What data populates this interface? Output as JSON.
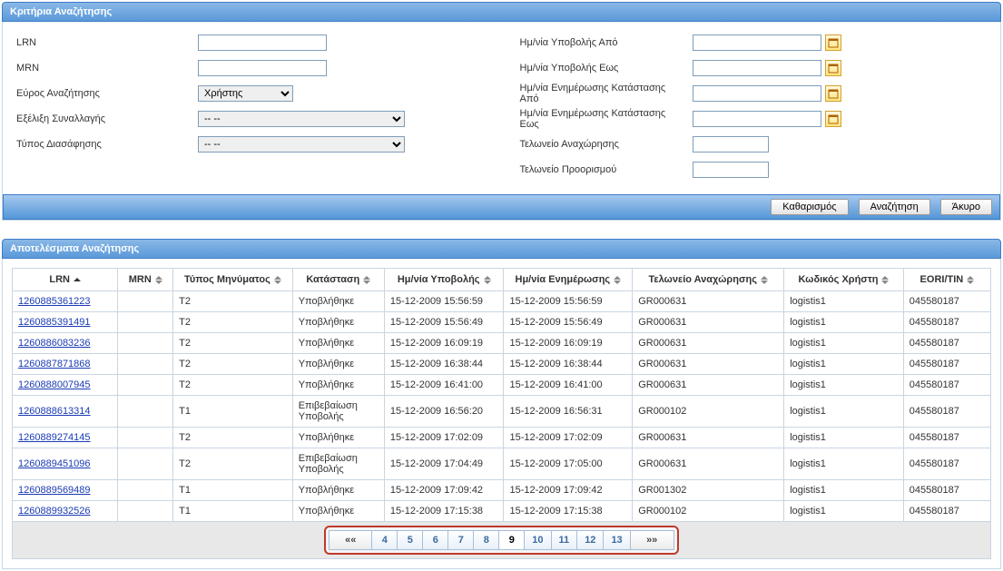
{
  "criteria": {
    "title": "Κριτήρια Αναζήτησης",
    "labels": {
      "lrn": "LRN",
      "mrn": "MRN",
      "scope": "Εύρος Αναζήτησης",
      "progress": "Εξέλιξη Συναλλαγής",
      "declType": "Τύπος Διασάφησης",
      "dateFrom": "Ημ/νία Υποβολής Από",
      "dateTo": "Ημ/νία Υποβολής Εως",
      "updateFrom": "Ημ/νία Ενημέρωσης Κατάστασης Από",
      "updateTo": "Ημ/νία Ενημέρωσης Κατάστασης Εως",
      "customsDep": "Τελωνείο Αναχώρησης",
      "customsDest": "Τελωνείο Προορισμού"
    },
    "values": {
      "lrn": "",
      "mrn": "",
      "scope": "Χρήστης",
      "progress": "-- --",
      "declType": "-- --",
      "dateFrom": "",
      "dateTo": "",
      "updateFrom": "",
      "updateTo": "",
      "customsDep": "",
      "customsDest": ""
    },
    "buttons": {
      "clear": "Καθαρισμός",
      "search": "Αναζήτηση",
      "cancel": "Άκυρο"
    }
  },
  "results": {
    "title": "Αποτελέσματα Αναζήτησης",
    "columns": {
      "lrn": "LRN",
      "mrn": "MRN",
      "msgType": "Τύπος Μηνύματος",
      "status": "Κατάσταση",
      "submitDate": "Ημ/νία Υποβολής",
      "updateDate": "Ημ/νία Ενημέρωσης",
      "customsDep": "Τελωνείο Αναχώρησης",
      "userCode": "Κωδικός Χρήστη",
      "eori": "EORI/TIN"
    },
    "rows": [
      {
        "lrn": "1260885361223",
        "mrn": "",
        "msgType": "T2",
        "status": "Υποβλήθηκε",
        "submitDate": "15-12-2009 15:56:59",
        "updateDate": "15-12-2009 15:56:59",
        "customsDep": "GR000631",
        "userCode": "logistis1",
        "eori": "045580187"
      },
      {
        "lrn": "1260885391491",
        "mrn": "",
        "msgType": "T2",
        "status": "Υποβλήθηκε",
        "submitDate": "15-12-2009 15:56:49",
        "updateDate": "15-12-2009 15:56:49",
        "customsDep": "GR000631",
        "userCode": "logistis1",
        "eori": "045580187"
      },
      {
        "lrn": "1260886083236",
        "mrn": "",
        "msgType": "T2",
        "status": "Υποβλήθηκε",
        "submitDate": "15-12-2009 16:09:19",
        "updateDate": "15-12-2009 16:09:19",
        "customsDep": "GR000631",
        "userCode": "logistis1",
        "eori": "045580187"
      },
      {
        "lrn": "1260887871868",
        "mrn": "",
        "msgType": "T2",
        "status": "Υποβλήθηκε",
        "submitDate": "15-12-2009 16:38:44",
        "updateDate": "15-12-2009 16:38:44",
        "customsDep": "GR000631",
        "userCode": "logistis1",
        "eori": "045580187"
      },
      {
        "lrn": "1260888007945",
        "mrn": "",
        "msgType": "T2",
        "status": "Υποβλήθηκε",
        "submitDate": "15-12-2009 16:41:00",
        "updateDate": "15-12-2009 16:41:00",
        "customsDep": "GR000631",
        "userCode": "logistis1",
        "eori": "045580187"
      },
      {
        "lrn": "1260888613314",
        "mrn": "",
        "msgType": "T1",
        "status": "Επιβεβαίωση Υποβολής",
        "submitDate": "15-12-2009 16:56:20",
        "updateDate": "15-12-2009 16:56:31",
        "customsDep": "GR000102",
        "userCode": "logistis1",
        "eori": "045580187"
      },
      {
        "lrn": "1260889274145",
        "mrn": "",
        "msgType": "T2",
        "status": "Υποβλήθηκε",
        "submitDate": "15-12-2009 17:02:09",
        "updateDate": "15-12-2009 17:02:09",
        "customsDep": "GR000631",
        "userCode": "logistis1",
        "eori": "045580187"
      },
      {
        "lrn": "1260889451096",
        "mrn": "",
        "msgType": "T2",
        "status": "Επιβεβαίωση Υποβολής",
        "submitDate": "15-12-2009 17:04:49",
        "updateDate": "15-12-2009 17:05:00",
        "customsDep": "GR000631",
        "userCode": "logistis1",
        "eori": "045580187"
      },
      {
        "lrn": "1260889569489",
        "mrn": "",
        "msgType": "T1",
        "status": "Υποβλήθηκε",
        "submitDate": "15-12-2009 17:09:42",
        "updateDate": "15-12-2009 17:09:42",
        "customsDep": "GR001302",
        "userCode": "logistis1",
        "eori": "045580187"
      },
      {
        "lrn": "1260889932526",
        "mrn": "",
        "msgType": "T1",
        "status": "Υποβλήθηκε",
        "submitDate": "15-12-2009 17:15:38",
        "updateDate": "15-12-2009 17:15:38",
        "customsDep": "GR000102",
        "userCode": "logistis1",
        "eori": "045580187"
      }
    ],
    "paginator": {
      "first": "««",
      "last": "»»",
      "pages": [
        "4",
        "5",
        "6",
        "7",
        "8",
        "9",
        "10",
        "11",
        "12",
        "13"
      ],
      "current": "9"
    }
  },
  "colors": {
    "headerFrom": "#8ab8e6",
    "headerTo": "#5a99d9",
    "border": "#c6d6e6",
    "link": "#1a3bb4",
    "paginatorOutline": "#c0392b"
  }
}
